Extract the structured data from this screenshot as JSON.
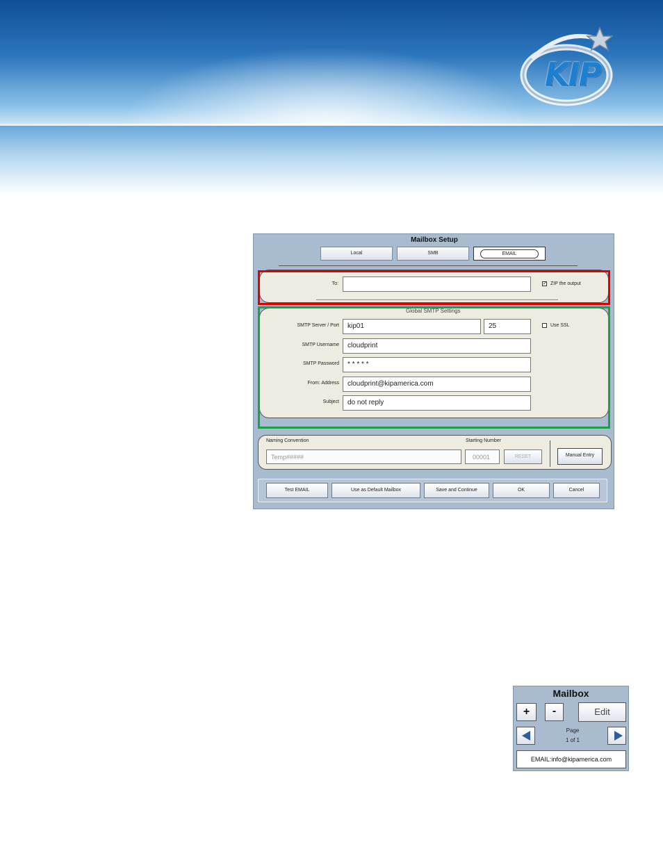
{
  "logo": {
    "text": "KIP"
  },
  "dialog": {
    "title": "Mailbox Setup",
    "tabs": [
      "Local",
      "SMB",
      "EMAIL"
    ],
    "to_label": "To:",
    "to_value": "",
    "zip_label": "ZIP the output",
    "zip_checked": true,
    "smtp_section_title": "Global SMTP Settings",
    "server_label": "SMTP Server / Port",
    "server_value": "kip01",
    "port_value": "25",
    "ssl_label": "Use SSL",
    "ssl_checked": false,
    "username_label": "SMTP Username",
    "username_value": "cloudprint",
    "password_label": "SMTP Password",
    "password_value": "* * * * *",
    "from_label": "From: Address",
    "from_value": "cloudprint@kipamerica.com",
    "subject_label": "Subject",
    "subject_value": "do not reply",
    "naming_label": "Naming Convention",
    "naming_value": "Temp#####",
    "starting_label": "Starting Number",
    "starting_value": "00001",
    "reset_label": "RESET",
    "manual_entry_label": "Manual Entry",
    "buttons": {
      "test": "Test EMAIL",
      "default": "Use as Default Mailbox",
      "save_continue": "Save and Continue",
      "ok": "OK",
      "cancel": "Cancel"
    }
  },
  "mailbox_widget": {
    "title": "Mailbox",
    "plus": "+",
    "minus": "-",
    "edit": "Edit",
    "page_label": "Page",
    "page_value": "1 of 1",
    "entry": "EMAIL:info@kipamerica.com"
  },
  "colors": {
    "dialog_bg": "#a9bccf",
    "panel_bg": "#eeece1",
    "highlight_red": "#e00000",
    "highlight_green": "#1ea04a"
  }
}
